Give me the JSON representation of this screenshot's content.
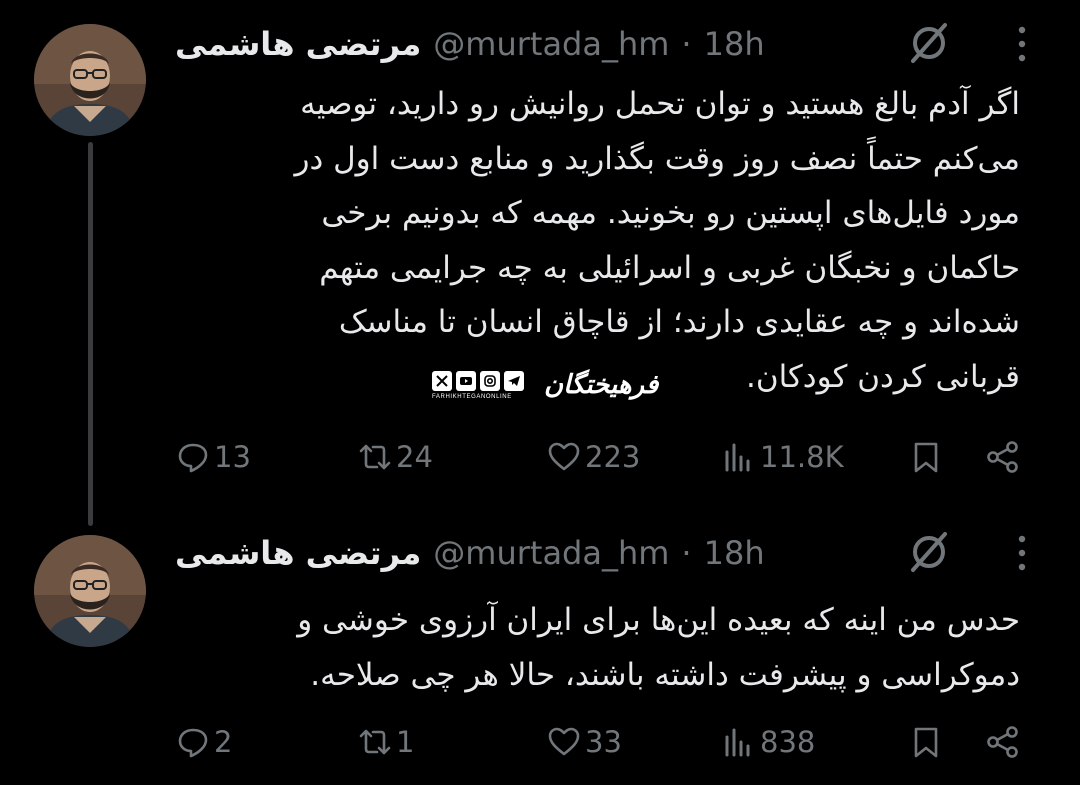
{
  "tweets": [
    {
      "display_name": "مرتضی هاشمی",
      "handle": "@murtada_hm",
      "separator": "·",
      "time": "18h",
      "lines": [
        "اگر آدم بالغ هستید و توان تحمل روانیش رو دارید، توصیه",
        "می‌کنم حتماً نصف روز وقت بگذارید و منابع دست اول در",
        "مورد فایل‌های اپستین رو بخونید. مهمه که بدونیم برخی",
        "حاکمان و نخبگان غربی و اسرائیلی به چه جرایمی متهم",
        "شده‌اند و چه عقایدی دارند؛ از قاچاق انسان تا مناسک",
        "قربانی کردن کودکان."
      ],
      "stats": {
        "replies": "13",
        "reposts": "24",
        "likes": "223",
        "views": "11.8K"
      }
    },
    {
      "display_name": "مرتضی هاشمی",
      "handle": "@murtada_hm",
      "separator": "·",
      "time": "18h",
      "lines": [
        "حدس من اینه که بعیده این‌ها برای ایران آرزوی خوشی و",
        "دموکراسی و پیشرفت داشته باشند، حالا هر چی صلاحه."
      ],
      "stats": {
        "replies": "2",
        "reposts": "1",
        "likes": "33",
        "views": "838"
      }
    }
  ],
  "watermark": {
    "logo_text": "فرهیختگان",
    "site_text": "FARHIKHTEGANONLINE",
    "social_icons": [
      "x-icon",
      "youtube-icon",
      "instagram-icon",
      "telegram-icon"
    ]
  },
  "colors": {
    "background": "#000000",
    "text": "#e7e9ea",
    "secondary": "#71767b",
    "thread_line": "#3a3b3c"
  }
}
